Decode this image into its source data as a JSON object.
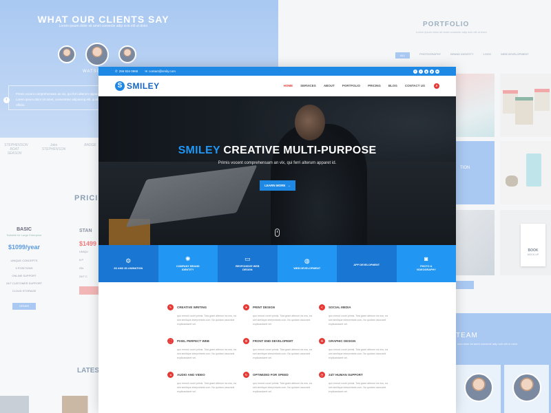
{
  "clients": {
    "title": "WHAT OUR CLIENTS SAY",
    "subtitle": "Lorem ipsum dolor sit amet consecte adip scin elit ut dolor",
    "name": "WATSON",
    "quote": "Primis vocent comprehensam an vix, qui ferri alterum apparet id. Lorem ipsum dolor sit amet, consectetur adipiscing elit, quidam officiis.",
    "prev_icon": "‹"
  },
  "logos": [
    "STEPHENSON BOAT SEASON",
    "Jake STEPHENSON",
    "BADGE"
  ],
  "pricing": {
    "title": "PRICING",
    "basic": {
      "name": "BASIC",
      "subtitle": "Suitable for Large Enterprise",
      "price": "$1099/year",
      "features": [
        "UNIQUE CONCEPTS",
        "5 POSITIONS",
        "ONLINE SUPPORT",
        "24/7 CUSTOMER SUPPORT",
        "CLOUD STORAGE"
      ],
      "button": "ORDER"
    },
    "standard": {
      "name": "STAN",
      "price": "$1499",
      "features": [
        "UNIQU",
        "5 P",
        "ON",
        "24/7 C"
      ]
    }
  },
  "latest": {
    "title": "LATEST"
  },
  "portfolio": {
    "title": "PORTFOLIO",
    "subtitle": "Lorem ipsum dolor sit amet consecte adip scin elit ut dolor",
    "tabs": [
      "ALL",
      "PHOTOGRAPHY",
      "BRAND IDENTITY",
      "LOGO",
      "WEB DEVELOPMENT"
    ],
    "book_label": "BOOK",
    "book_sub": "MOCK-UP",
    "tile_label": "TION"
  },
  "team": {
    "title": "TEAM",
    "subtitle": "cum dolor sit amet consecte adip scin elit ut dolor"
  },
  "site": {
    "topbar": {
      "phone": "256 834 0968",
      "email": "contact@smily.com",
      "socials": [
        "f",
        "t",
        "g",
        "p",
        "in"
      ]
    },
    "logo": {
      "mark": "S",
      "text": "SMILEY"
    },
    "nav": [
      "HOME",
      "SERVICES",
      "ABOUT",
      "PORTFOLIO",
      "PRICING",
      "BLOG",
      "CONTACT US"
    ],
    "search_icon": "⌕",
    "hero": {
      "brand": "SMILEY",
      "title_rest": " CREATIVE MULTI-PURPOSE",
      "subtitle": "Primis vocent comprehensam an vix, qui ferri alterum apparet id.",
      "button": "LEARN MORE",
      "button_icon": "→"
    },
    "services": [
      {
        "icon": "⚙",
        "label": "2D AND 3D ANIMATION"
      },
      {
        "icon": "✺",
        "label": "COMPANY BRAND IDENTITY"
      },
      {
        "icon": "▭",
        "label": "RESPONSIVE WEB DESIGN"
      },
      {
        "icon": "◍",
        "label": "WEB DEVELOPMENT"
      },
      {
        "icon": "",
        "label": "APP DEVELOPMENT"
      },
      {
        "icon": "◙",
        "label": "PHOTO & VIDEOGRAPHY"
      }
    ],
    "features": [
      {
        "icon": "✎",
        "title": "CREATIVE WRITING",
        "desc": "quo ermod vocet primis. Tota grant alterum ea eos, ea sint similique interpretaris cum. No quidam oscuranti explicandaret vel."
      },
      {
        "icon": "♥",
        "title": "PRINT DESIGN",
        "desc": "quo ermod vocet primis. Tota grant alterum ea eos, ea sint similique interpretaris cum. No quidam oscuranti explicandaret vel."
      },
      {
        "icon": "<",
        "title": "SOCIAL MEDIA",
        "desc": "quo ermod vocet primis. Tota grant alterum ea eos, ea sint similique interpretaris cum. No quidam oscuranti explicandaret vel."
      },
      {
        "icon": "⛶",
        "title": "PIXEL PERFECT WEB",
        "desc": "quo ermod vocet primis. Tota grant alterum ea eos, ea sint similique interpretaris cum. No quidam oscuranti explicandaret vel."
      },
      {
        "icon": "⚙",
        "title": "FRONT END DEVELOPEMT",
        "desc": "quo ermod vocet primis. Tota grant alterum ea eos, ea sint similique interpretaris cum. No quidam oscuranti explicandaret vel."
      },
      {
        "icon": "✣",
        "title": "GRAPHIC DESIGN",
        "desc": "quo ermod vocet primis. Tota grant alterum ea eos, ea sint similique interpretaris cum. No quidam oscuranti explicandaret vel."
      },
      {
        "icon": "◂",
        "title": "AUDIO AND VIDEO",
        "desc": "quo ermod vocet primis. Tota grant alterum ea eos, ea sint similique interpretaris cum. No quidam oscuranti explicandaret vel."
      },
      {
        "icon": "↻",
        "title": "OPTIMIZED FOR SPEED",
        "desc": "quo ermod vocet primis. Tota grant alterum ea eos, ea sint similique interpretaris cum. No quidam oscuranti explicandaret vel."
      },
      {
        "icon": "◷",
        "title": "24/7 HUMAN SUPPORT",
        "desc": "quo ermod vocet primis. Tota grant alterum ea eos, ea sint similique interpretaris cum. No quidam oscuranti explicandaret vel."
      }
    ]
  },
  "colors": {
    "primary": "#1e88e5",
    "accent": "#e53935",
    "background_soft": "#a9c8f2"
  }
}
